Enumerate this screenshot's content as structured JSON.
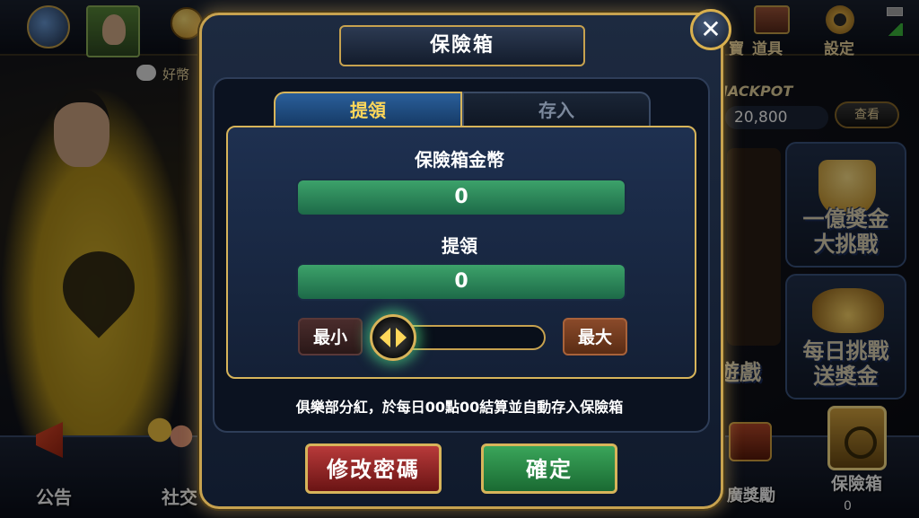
{
  "background": {
    "friends_label": "好幣",
    "top_labels": {
      "props": "道具",
      "settings": "設定",
      "truncated_left": "寶"
    },
    "jackpot": {
      "label": "JACKPOT",
      "value": "20,800",
      "view_button": "查看"
    },
    "promo_cards": [
      {
        "title_line1": "一億獎金",
        "title_line2": "大挑戰"
      },
      {
        "title_line1": "每日挑戰",
        "title_line2": "送獎金"
      }
    ],
    "left_card_text": "遊戲",
    "bottom": {
      "announcement": "公告",
      "social": "社交",
      "rewards": "廣獎勵",
      "safe": "保險箱",
      "safe_count": "0"
    }
  },
  "dialog": {
    "title": "保險箱",
    "close_label": "✕",
    "tabs": [
      {
        "label": "提領",
        "active": true
      },
      {
        "label": "存入",
        "active": false
      }
    ],
    "safe_balance_label": "保險箱金幣",
    "safe_balance_value": "0",
    "withdraw_label": "提領",
    "withdraw_value": "0",
    "min_label": "最小",
    "max_label": "最大",
    "notice": "俱樂部分紅，於每日00點00結算並自動存入保險箱",
    "change_password_label": "修改密碼",
    "confirm_label": "確定"
  }
}
